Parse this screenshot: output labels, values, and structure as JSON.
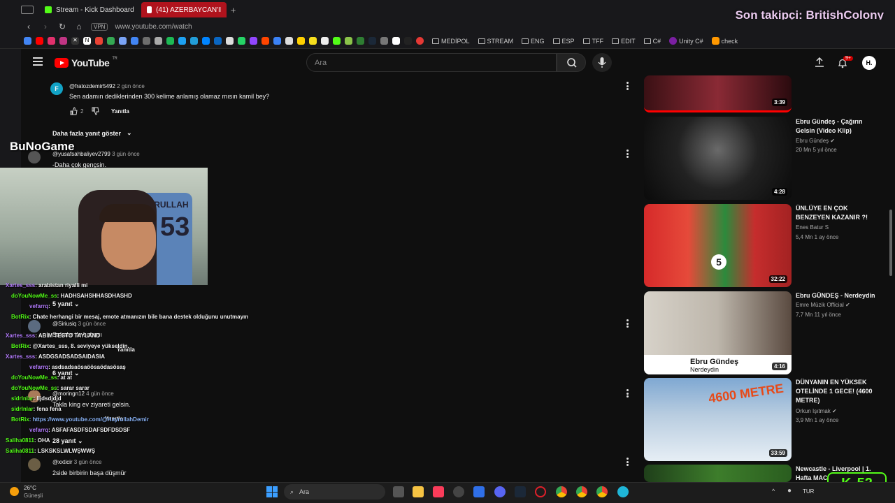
{
  "browser": {
    "tabs": [
      {
        "title": "Stream - Kick Dashboard"
      },
      {
        "title": "(41) AZERBAYCAN'IN EN G"
      }
    ],
    "url": "www.youtube.com/watch",
    "vpn_label": "VPN",
    "bookmarks": [
      "MEDİPOL",
      "STREAM",
      "ENG",
      "ESP",
      "TFF",
      "EDIT",
      "C#",
      "Unity C#",
      "check"
    ]
  },
  "overlay": {
    "follower_text": "Son takipçi: BritishColony",
    "channel_logo": "BuNoGame",
    "jersey_name": "HAYRULLAH",
    "jersey_number": "53",
    "kick_viewers": "52"
  },
  "youtube": {
    "logo": "YouTube",
    "region": "TR",
    "search_placeholder": "Ara",
    "notif_count": "9+",
    "avatar_letter": "H."
  },
  "comments": [
    {
      "handle": "@fratozdemir5492",
      "time": "2 gün önce",
      "text": "Sen adamın dediklerinden 300 kelime anlamış olamaz mısın kamil bey?",
      "likes": "2",
      "reply": "Yanıtla"
    },
    {
      "more": "Daha fazla yanıt göster"
    },
    {
      "handle": "@yusafsahbaliyev2799",
      "time": "3 gün önce",
      "text": "-Daha çok gençsin."
    },
    {
      "replies": "5 yanıt"
    },
    {
      "handle": "@Siriusiq",
      "time": "3 gün önce",
      "text": "Sakalın ile babası",
      "reply": "Yanıtla"
    },
    {
      "replies": "6 yanıt"
    },
    {
      "handle": "@moringn12",
      "time": "4 gün önce",
      "text": "Takla king ev ziyareti gelsin.",
      "reply": "Yanıtla"
    },
    {
      "replies": "28 yanıt"
    },
    {
      "handle": "@xxticir",
      "time": "3 gün önce",
      "text": "2side birbirin başa düşmür"
    }
  ],
  "chat": [
    {
      "user": "Xartes_sss",
      "msg": ": arabistan riyalli mi",
      "color": "#b57cff"
    },
    {
      "user": "doYouNowMe_ss",
      "msg": ": HADHSAHSHHASDHASHD",
      "color": "#53fc18"
    },
    {
      "user": "vefarrq",
      "msg": ":",
      "color": "#b57cff"
    },
    {
      "user": "BotRix",
      "msg": ": Chate herhangi bir mesaj, emote atmanızın bile bana destek olduğunu unutmayın",
      "color": "#53fc18"
    },
    {
      "user": "Xartes_sss",
      "msg": ": ABİM TESTO TAYLAND",
      "color": "#b57cff"
    },
    {
      "user": "BotRix",
      "msg": ": @Xartes_sss, 8. seviyeye yükseldin.",
      "color": "#53fc18"
    },
    {
      "user": "Xartes_sss",
      "msg": ": ASDGSADSADSAIDASIA",
      "color": "#b57cff"
    },
    {
      "user": "vefarrq",
      "msg": ": asdsadsaösaöösaödasösaş",
      "color": "#b57cff"
    },
    {
      "user": "doYouNowMe_ss",
      "msg": ": at at",
      "color": "#53fc18"
    },
    {
      "user": "doYouNowMe_ss",
      "msg": ": sarar sarar",
      "color": "#53fc18"
    },
    {
      "user": "sidrlnlar",
      "msg": ": lljdsdjdjd",
      "color": "#53fc18"
    },
    {
      "user": "sidrlnlar",
      "msg": ": fena fena",
      "color": "#53fc18"
    },
    {
      "user": "BotRix",
      "msg": ": https://www.youtube.com/@HayrullahDemir",
      "color": "#53fc18"
    },
    {
      "user": "vefarrq",
      "msg": ": ASFAFASDFSDAFSDFDSDSF",
      "color": "#b57cff"
    },
    {
      "user": "Saliha0811",
      "msg": ": OHA",
      "color": "#53fc18"
    },
    {
      "user": "Saliha0811",
      "msg": ": LSKSKSLWLWŞWWŞ",
      "color": "#53fc18"
    }
  ],
  "sidebar_videos": [
    {
      "title": "",
      "channel": "",
      "meta": "",
      "duration": "3:39"
    },
    {
      "title": "Ebru Gündeş - Çağırın Gelsin (Video Klip)",
      "channel": "Ebru Gündeş",
      "meta": "20 Mn  5 yıl önce",
      "duration": "4:28"
    },
    {
      "title": "ÜNLÜYE EN ÇOK BENZEYEN KAZANIR ?!",
      "channel": "Enes Batur S",
      "meta": "5,4 Mn  1 ay önce",
      "duration": "32:22"
    },
    {
      "title": "Ebru GÜNDEŞ - Nerdeydin",
      "channel": "Emre Müzik Official",
      "meta": "7,7 Mn  11 yıl önce",
      "duration": "4:16",
      "thumb_title": "Ebru Gündeş",
      "thumb_sub": "Nerdeydin"
    },
    {
      "title": "DÜNYANIN EN YÜKSEK OTELİNDE 1 GECE! (4600 METRE)",
      "channel": "Orkun Işıtmak",
      "meta": "3,9 Mn  1 ay önce",
      "duration": "33:59",
      "thumb_text": "4600 METRE"
    },
    {
      "title": "Newcastle - Liverpool | 1. Hafta MAC",
      "channel": "",
      "meta": "",
      "duration": ""
    }
  ],
  "taskbar": {
    "weather_temp": "26°C",
    "weather_desc": "Güneşli",
    "search_placeholder": "Ara",
    "language": "TUR"
  }
}
